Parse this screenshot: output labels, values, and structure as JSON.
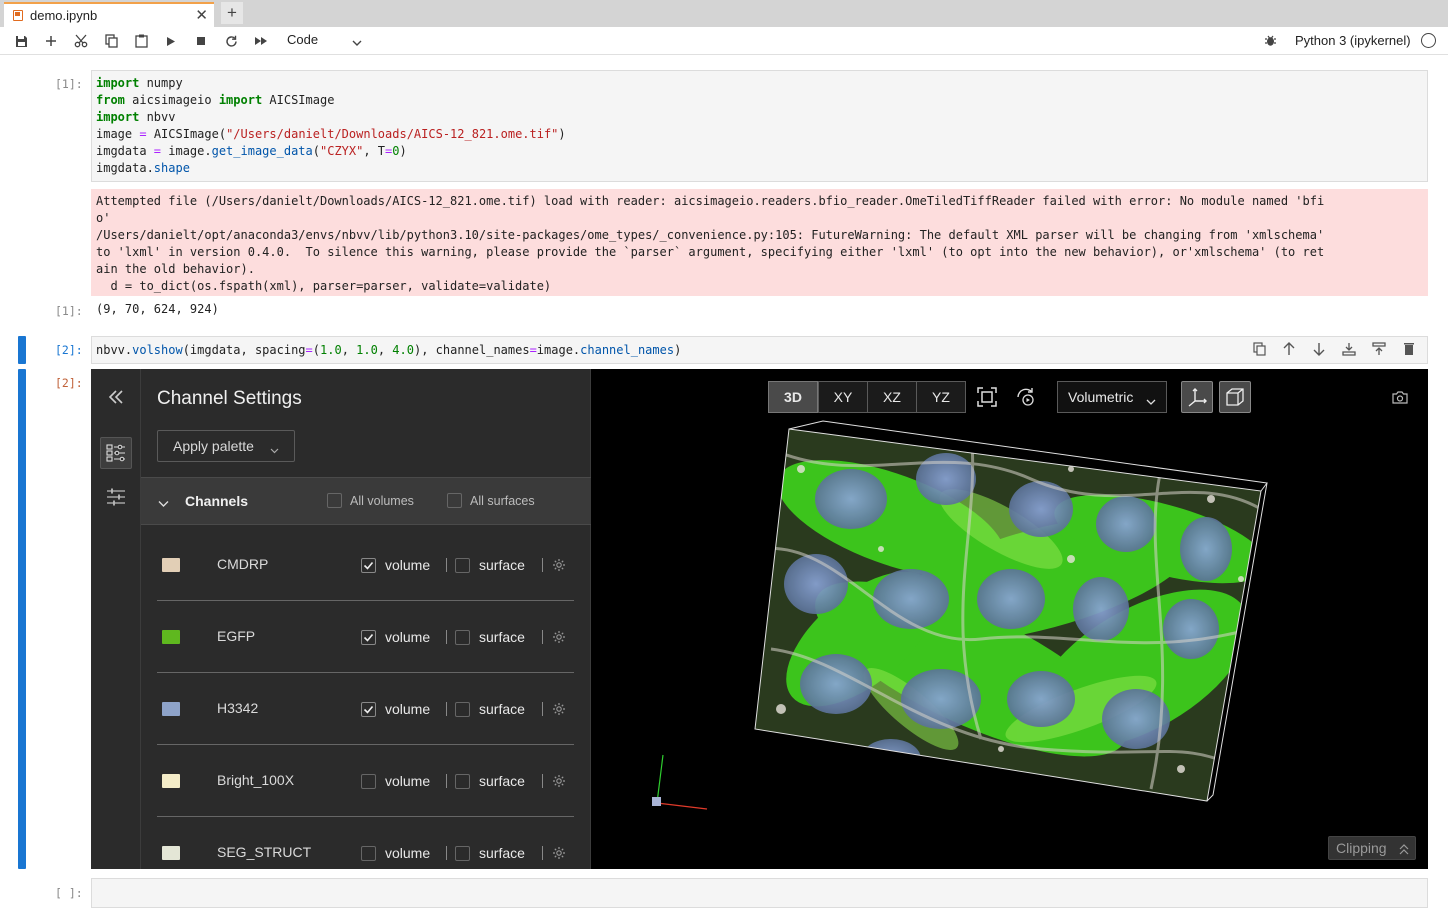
{
  "tab": {
    "title": "demo.ipynb",
    "close": "✕",
    "new": "+"
  },
  "toolbar": {
    "cell_type": "Code",
    "kernel": "Python 3 (ipykernel)"
  },
  "cells": [
    {
      "in_prompt": "[1]:",
      "code_lines": [
        "import numpy",
        "from aicsimageio import AICSImage",
        "import nbvv",
        "image = AICSImage(\"/Users/danielt/Downloads/AICS-12_821.ome.tif\")",
        "imgdata = image.get_image_data(\"CZYX\", T=0)",
        "imgdata.shape"
      ],
      "stderr_lines": [
        "Attempted file (/Users/danielt/Downloads/AICS-12_821.ome.tif) load with reader: aicsimageio.readers.bfio_reader.OmeTiledTiffReader failed with error: No module named 'bfi",
        "o'",
        "/Users/danielt/opt/anaconda3/envs/nbvv/lib/python3.10/site-packages/ome_types/_convenience.py:105: FutureWarning: The default XML parser will be changing from 'xmlschema'",
        "to 'lxml' in version 0.4.0.  To silence this warning, please provide the `parser` argument, specifying either 'lxml' (to opt into the new behavior), or'xmlschema' (to ret",
        "ain the old behavior).",
        "  d = to_dict(os.fspath(xml), parser=parser, validate=validate)"
      ],
      "out_prompt": "[1]:",
      "output": "(9, 70, 624, 924)"
    },
    {
      "in_prompt": "[2]:",
      "code": "nbvv.volshow(imgdata, spacing=(1.0, 1.0, 4.0), channel_names=image.channel_names)",
      "out_prompt": "[2]:"
    },
    {
      "in_prompt": "[ ]:"
    }
  ],
  "viewer": {
    "panel_title": "Channel Settings",
    "apply_palette": "Apply palette",
    "channels_header": "Channels",
    "all_volumes": "All volumes",
    "all_surfaces": "All surfaces",
    "volume_label": "volume",
    "surface_label": "surface",
    "channels": [
      {
        "name": "CMDRP",
        "color": "#e2cfb6",
        "volume": true,
        "surface": false
      },
      {
        "name": "EGFP",
        "color": "#5fb81f",
        "volume": true,
        "surface": false
      },
      {
        "name": "H3342",
        "color": "#8ea3c9",
        "volume": true,
        "surface": false
      },
      {
        "name": "Bright_100X",
        "color": "#f4ecc8",
        "volume": false,
        "surface": false
      },
      {
        "name": "SEG_STRUCT",
        "color": "#e4e6d6",
        "volume": false,
        "surface": false
      }
    ],
    "view_modes": [
      "3D",
      "XY",
      "XZ",
      "YZ"
    ],
    "active_view": "3D",
    "render_mode": "Volumetric",
    "clipping": "Clipping"
  },
  "colors": {
    "accent": "#1976d2",
    "stderr_bg": "#fddddd",
    "panel_bg": "#2b2b2b"
  }
}
